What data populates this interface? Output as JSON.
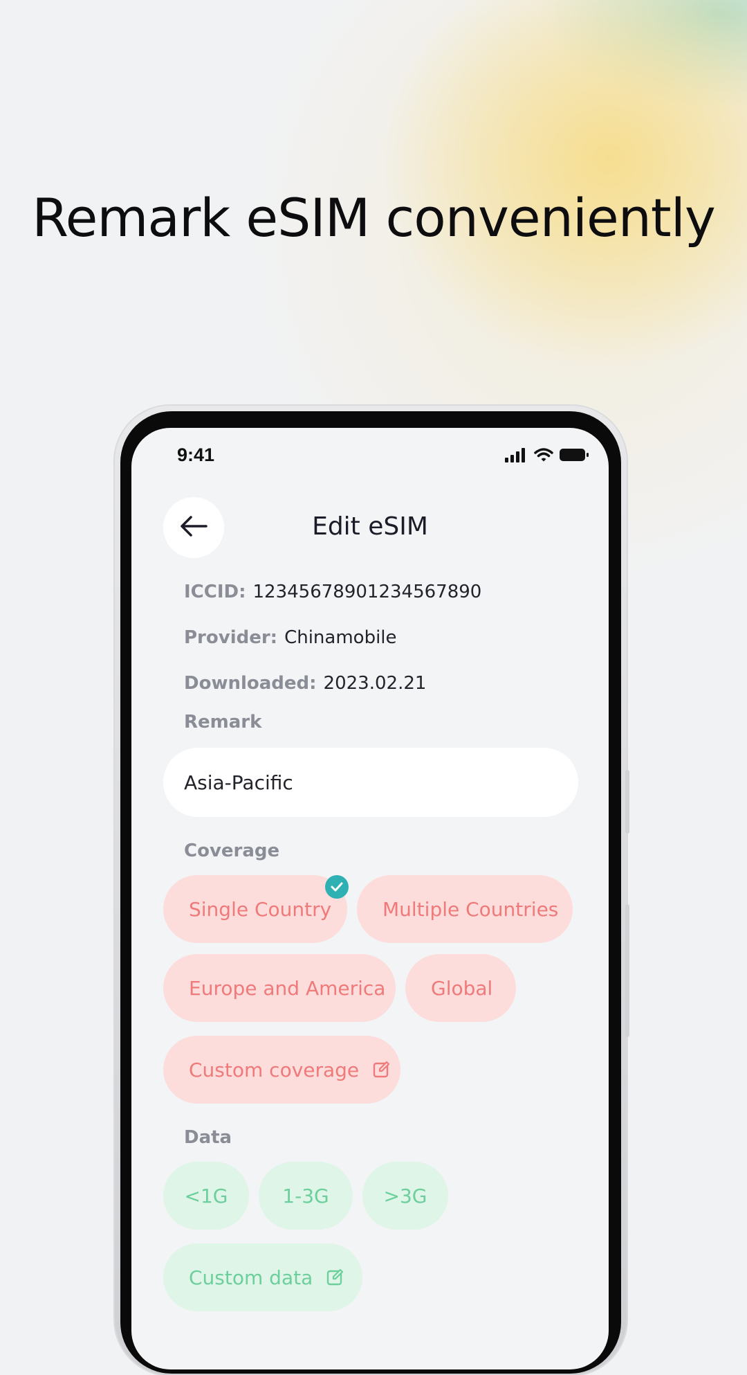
{
  "headline": "Remark eSIM conveniently",
  "status_bar": {
    "time": "9:41"
  },
  "header": {
    "title": "Edit eSIM"
  },
  "info": {
    "iccid_label": "ICCID:",
    "iccid_value": "12345678901234567890",
    "provider_label": "Provider:",
    "provider_value": "Chinamobile",
    "downloaded_label": "Downloaded:",
    "downloaded_value": "2023.02.21"
  },
  "remark": {
    "label": "Remark",
    "value": "Asia-Pacific"
  },
  "coverage": {
    "label": "Coverage",
    "options": [
      "Single Country",
      "Multiple Countries",
      "Europe and America",
      "Global",
      "Custom coverage"
    ],
    "selected": "Single Country"
  },
  "data_section": {
    "label": "Data",
    "options": [
      "<1G",
      "1-3G",
      ">3G",
      "Custom data"
    ]
  },
  "colors": {
    "coverage_chip_bg": "#fddcdc",
    "coverage_chip_text": "#ef7a7a",
    "data_chip_bg": "#dff5e8",
    "data_chip_text": "#6ccf9c",
    "check_badge": "#2fb0b3"
  },
  "icons": [
    "back-arrow-icon",
    "signal-icon",
    "wifi-icon",
    "battery-icon",
    "check-icon",
    "edit-icon"
  ]
}
